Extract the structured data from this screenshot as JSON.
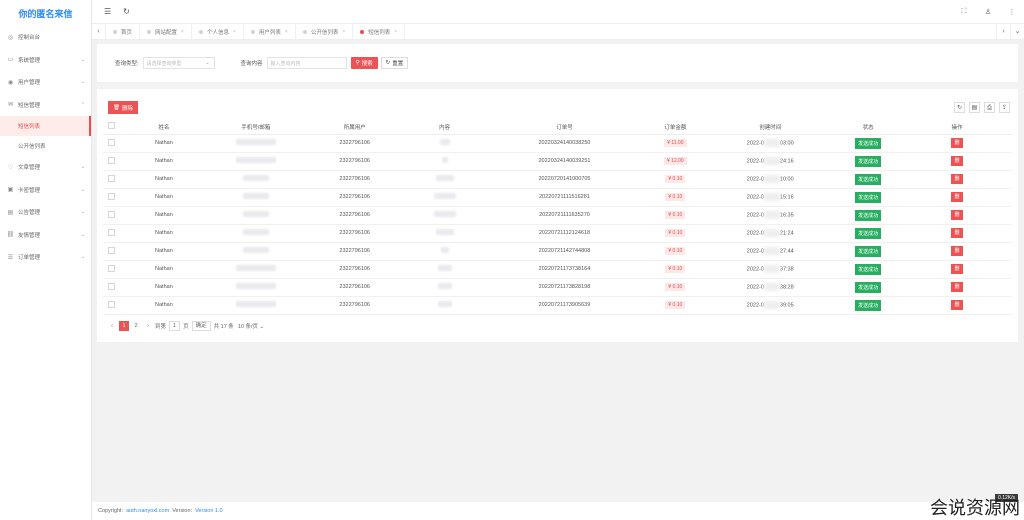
{
  "app": {
    "title": "你的匿名来信"
  },
  "sidebar": {
    "items": [
      {
        "label": "控制台台",
        "icon": "dashboard-icon",
        "has_children": false
      },
      {
        "label": "系统管理",
        "icon": "monitor-icon",
        "has_children": true
      },
      {
        "label": "用户管理",
        "icon": "user-icon",
        "has_children": true
      },
      {
        "label": "短信管理",
        "icon": "message-icon",
        "has_children": true,
        "expanded": true
      },
      {
        "label": "文章管理",
        "icon": "heart-icon",
        "has_children": true
      },
      {
        "label": "卡密管理",
        "icon": "card-icon",
        "has_children": true
      },
      {
        "label": "公告管理",
        "icon": "notice-icon",
        "has_children": true
      },
      {
        "label": "友情管理",
        "icon": "link-icon",
        "has_children": true
      },
      {
        "label": "订单管理",
        "icon": "order-icon",
        "has_children": true
      }
    ],
    "sub_items": [
      {
        "label": "短信列表",
        "active": true
      },
      {
        "label": "公开信列表",
        "active": false
      }
    ]
  },
  "tabs": [
    {
      "label": "首页",
      "active": false
    },
    {
      "label": "网站配置",
      "active": false
    },
    {
      "label": "个人信息",
      "active": false
    },
    {
      "label": "用户列表",
      "active": false
    },
    {
      "label": "公开信列表",
      "active": false
    },
    {
      "label": "短信列表",
      "active": true
    }
  ],
  "search": {
    "type_label": "查询类型:",
    "type_placeholder": "请选择查询类型",
    "content_label": "查询内容",
    "content_placeholder": "输入查询内容",
    "search_button": "搜索",
    "reset_button": "重置"
  },
  "toolbar": {
    "delete_button": "删除"
  },
  "table": {
    "headers": [
      "姓名",
      "手机号/邮箱",
      "所属用户",
      "内容",
      "订单号",
      "订单金额",
      "创建时间",
      "状态",
      "操作"
    ],
    "rows": [
      {
        "name": "Nathan",
        "user": "2322796106",
        "order": "20220324140038250",
        "amount": "¥ 11.00",
        "time_prefix": "2022-0",
        "time_suffix": "03:00",
        "status": "发送成功"
      },
      {
        "name": "Nathan",
        "user": "2322796106",
        "order": "20220324140039251",
        "amount": "¥ 12.00",
        "time_prefix": "2022-0",
        "time_suffix": "24:16",
        "status": "发送成功"
      },
      {
        "name": "Nathan",
        "user": "2322796106",
        "order": "20220720141000705",
        "amount": "¥ 0.10",
        "time_prefix": "2022-0",
        "time_suffix": "10:00",
        "status": "发送成功"
      },
      {
        "name": "Nathan",
        "user": "2322796106",
        "order": "20220721111516281",
        "amount": "¥ 0.10",
        "time_prefix": "2022-0",
        "time_suffix": "15:16",
        "status": "发送成功"
      },
      {
        "name": "Nathan",
        "user": "2322796106",
        "order": "20220721111635270",
        "amount": "¥ 0.10",
        "time_prefix": "2022-0",
        "time_suffix": "16:35",
        "status": "发送成功"
      },
      {
        "name": "Nathan",
        "user": "2322796106",
        "order": "20220721112124618",
        "amount": "¥ 0.10",
        "time_prefix": "2022-0",
        "time_suffix": "21:24",
        "status": "发送成功"
      },
      {
        "name": "Nathan",
        "user": "2322796106",
        "order": "20220721142744808",
        "amount": "¥ 0.10",
        "time_prefix": "2022-0",
        "time_suffix": "27:44",
        "status": "发送成功"
      },
      {
        "name": "Nathan",
        "user": "2322796106",
        "order": "20220721173738164",
        "amount": "¥ 0.10",
        "time_prefix": "2022-0",
        "time_suffix": "37:38",
        "status": "发送成功"
      },
      {
        "name": "Nathan",
        "user": "2322796106",
        "order": "20220721173828198",
        "amount": "¥ 0.10",
        "time_prefix": "2022-0",
        "time_suffix": "38:28",
        "status": "发送成功"
      },
      {
        "name": "Nathan",
        "user": "2322796106",
        "order": "20220721173905639",
        "amount": "¥ 0.10",
        "time_prefix": "2022-0",
        "time_suffix": "39:05",
        "status": "发送成功"
      }
    ],
    "delete_row_label": "删"
  },
  "pagination": {
    "pages": [
      "1",
      "2"
    ],
    "current": "1",
    "goto_label": "到第",
    "goto_value": "1",
    "page_unit": "页",
    "confirm": "确定",
    "total": "共 17 条",
    "per_page": "10 条/页"
  },
  "footer": {
    "copyright_label": "Copyright:",
    "domain": "auth.nanyoxl.com",
    "version_label": "Version:",
    "version": "Version 1.0"
  },
  "watermark": {
    "text": "会说资源网",
    "badge": "0.12K/s"
  },
  "colors": {
    "accent": "#ea5455",
    "brand": "#2d8cf0",
    "success": "#27ae60"
  }
}
